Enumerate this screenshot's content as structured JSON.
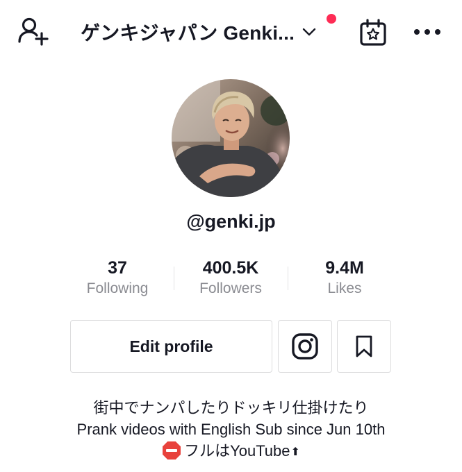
{
  "header": {
    "account_name": "ゲンキジャパン Genki...",
    "icons": {
      "add_user": "add-user-icon",
      "chevron": "chevron-down-icon",
      "calendar": "calendar-star-icon",
      "more": "more-horizontal-icon"
    },
    "notification_dot_color": "#fe2c55"
  },
  "profile": {
    "username": "@genki.jp",
    "avatar": "profile-photo"
  },
  "stats": [
    {
      "value": "37",
      "label": "Following"
    },
    {
      "value": "400.5K",
      "label": "Followers"
    },
    {
      "value": "9.4M",
      "label": "Likes"
    }
  ],
  "actions": {
    "edit_profile_label": "Edit profile",
    "instagram_icon": "instagram-icon",
    "favorites_icon": "bookmark-icon"
  },
  "bio": {
    "line1": "街中でナンパしたりドッキリ仕掛けたり",
    "line2": "Prank videos with English Sub since Jun 10th",
    "line3_prefix_icon": "stop-sign-icon",
    "line3": "フルはYouTube",
    "line3_suffix": "⬆"
  },
  "colors": {
    "text_primary": "#161823",
    "text_secondary": "#8a8b91",
    "border": "#dcdcdd",
    "accent": "#fe2c55"
  }
}
